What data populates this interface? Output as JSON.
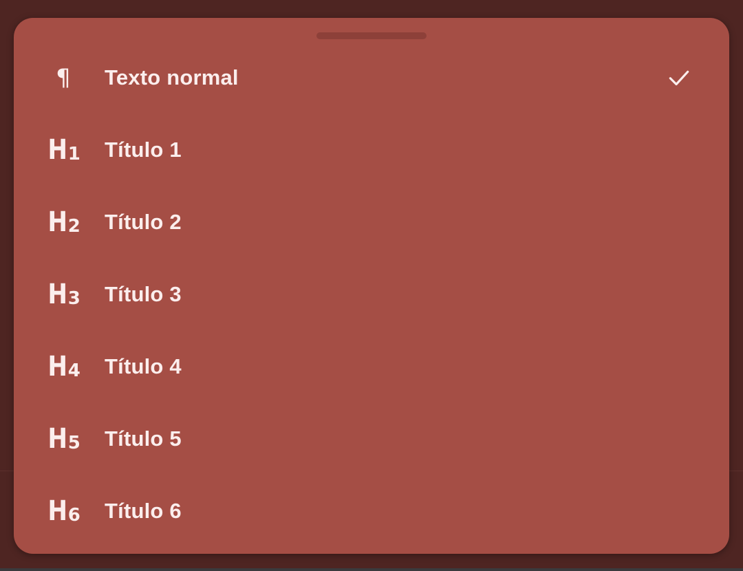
{
  "menu": {
    "items": [
      {
        "label": "Texto normal",
        "icon": "paragraph-icon",
        "selected": true
      },
      {
        "label": "Título 1",
        "icon": "heading-1-icon",
        "level": "1",
        "selected": false
      },
      {
        "label": "Título 2",
        "icon": "heading-2-icon",
        "level": "2",
        "selected": false
      },
      {
        "label": "Título 3",
        "icon": "heading-3-icon",
        "level": "3",
        "selected": false
      },
      {
        "label": "Título 4",
        "icon": "heading-4-icon",
        "level": "4",
        "selected": false
      },
      {
        "label": "Título 5",
        "icon": "heading-5-icon",
        "level": "5",
        "selected": false
      },
      {
        "label": "Título 6",
        "icon": "heading-6-icon",
        "level": "6",
        "selected": false
      }
    ]
  },
  "colors": {
    "sheet": "#a54e45",
    "backdrop": "#4e2522",
    "text": "#fbeeed",
    "handle": "#8d4039"
  }
}
